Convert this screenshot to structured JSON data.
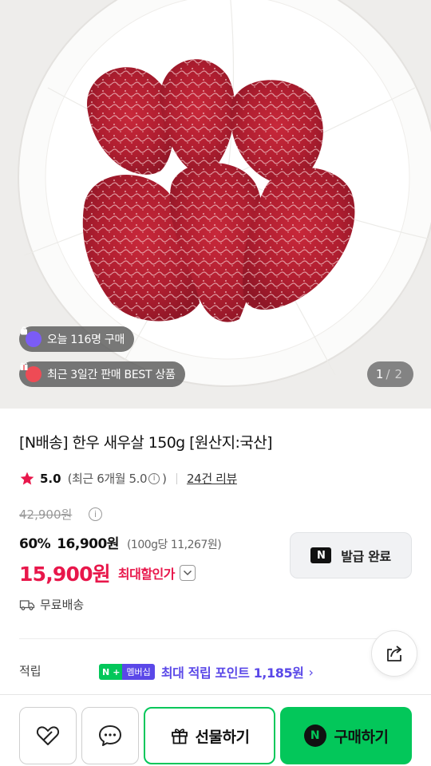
{
  "hero": {
    "today_badge": "오늘 116명 구매",
    "best_badge": "최근 3일간 판매 BEST 상품",
    "pager_current": "1",
    "pager_sep": "/",
    "pager_total": "2"
  },
  "product": {
    "title": "[N배송] 한우 새우살 150g [원산지:국산]",
    "rating_score": "5.0",
    "rating_recent": "(최근 6개월 5.0",
    "rating_recent_close": ")",
    "review_link": "24건 리뷰",
    "original_price": "42,900원",
    "discount_rate": "60%",
    "sale_price": "16,900원",
    "unit_price": "(100g당 11,267원)",
    "max_discount_price": "15,900원",
    "max_discount_label": "최대할인가",
    "coupon_label": "발급 완료",
    "coupon_logo": "N",
    "shipping": "무료배송"
  },
  "points": {
    "label": "적립",
    "badge_n": "N",
    "badge_plus": "+",
    "badge_member": "멤버십",
    "text": "최대 적립 포인트 1,185원",
    "chevron": "›"
  },
  "bottom_bar": {
    "gift_label": "선물하기",
    "buy_label": "구매하기",
    "buy_logo": "N"
  },
  "colors": {
    "naver_green": "#03c75a",
    "price_red": "#e8174b",
    "membership_purple": "#5a48e8"
  }
}
